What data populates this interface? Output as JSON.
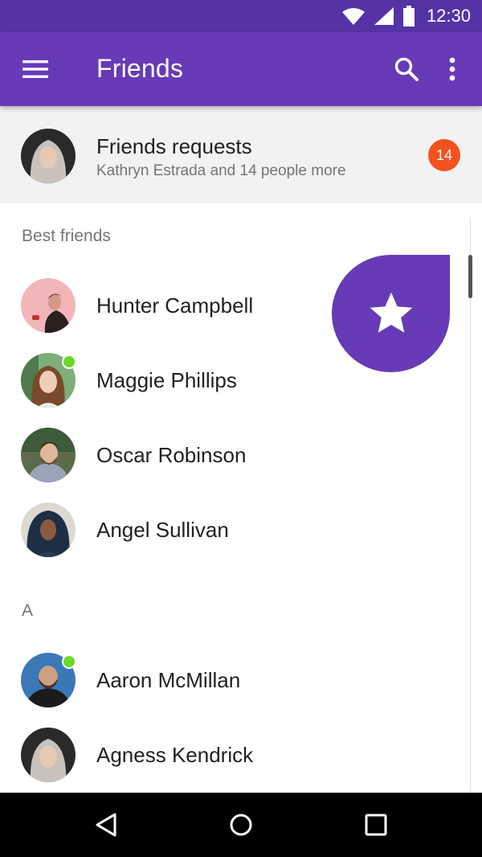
{
  "status_bar": {
    "time": "12:30"
  },
  "app_bar": {
    "title": "Friends"
  },
  "friend_requests": {
    "title": "Friends requests",
    "subtitle": "Kathryn Estrada and 14 people more",
    "count": "14"
  },
  "sections": {
    "best_friends": {
      "label": "Best friends"
    },
    "a": {
      "label": "A"
    }
  },
  "best_friends": [
    {
      "name": "Hunter Campbell",
      "online": false
    },
    {
      "name": "Maggie Phillips",
      "online": true
    },
    {
      "name": "Oscar Robinson",
      "online": false
    },
    {
      "name": "Angel Sullivan",
      "online": false
    }
  ],
  "a_friends": [
    {
      "name": "Aaron McMillan",
      "online": true
    },
    {
      "name": "Agness Kendrick",
      "online": false
    }
  ],
  "colors": {
    "primary": "#673AB7",
    "primary_dark": "#5533A6",
    "badge": "#F4511E",
    "online": "#6BD92B"
  },
  "icons": {
    "menu": "hamburger-menu-icon",
    "search": "search-icon",
    "more": "more-vert-icon",
    "fast_scroll": "star-icon",
    "back": "back-triangle-icon",
    "home": "home-circle-icon",
    "recents": "recents-square-icon"
  }
}
